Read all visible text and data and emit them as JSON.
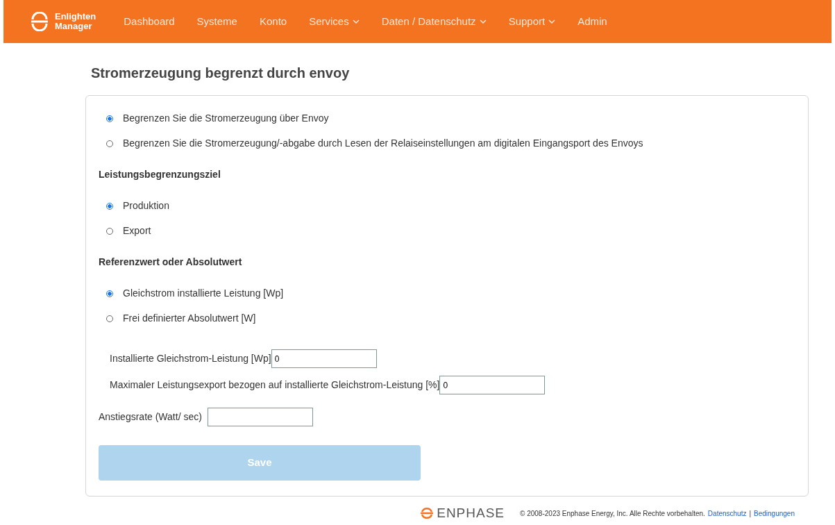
{
  "navbar": {
    "brand": [
      "Enlighten",
      "Manager"
    ],
    "items": [
      {
        "label": "Dashboard",
        "dropdown": false
      },
      {
        "label": "Systeme",
        "dropdown": false
      },
      {
        "label": "Konto",
        "dropdown": false
      },
      {
        "label": "Services",
        "dropdown": true
      },
      {
        "label": "Daten / Datenschutz",
        "dropdown": true
      },
      {
        "label": "Support",
        "dropdown": true
      },
      {
        "label": "Admin",
        "dropdown": false
      }
    ]
  },
  "title": "Stromerzeugung begrenzt durch envoy",
  "mode_options": [
    {
      "label": "Begrenzen Sie die Stromerzeugung über Envoy",
      "selected": true
    },
    {
      "label": "Begrenzen Sie die Stromerzeugung/-abgabe durch Lesen der Relaiseinstellungen am digitalen Eingangsport des Envoys",
      "selected": false
    }
  ],
  "target": {
    "heading": "Leistungsbegrenzungsziel",
    "options": [
      {
        "label": "Produktion",
        "selected": true
      },
      {
        "label": "Export",
        "selected": false
      }
    ]
  },
  "reference": {
    "heading": "Referenzwert oder Absolutwert",
    "options": [
      {
        "label": "Gleichstrom installierte Leistung [Wp]",
        "selected": true
      },
      {
        "label": "Frei definierter Absolutwert [W]",
        "selected": false
      }
    ]
  },
  "limit_fields": [
    {
      "label": "Installierte Gleichstrom-Leistung [Wp]",
      "value": "0"
    },
    {
      "label": "Maximaler Leistungsexport bezogen auf installierte Gleichstrom-Leistung [%]",
      "value": "0"
    }
  ],
  "ramp_field": {
    "label": "Anstiegsrate (Watt/ sec)"
  },
  "save_button": {
    "label": "Save",
    "disabled": true
  },
  "footer": {
    "logo": "ENPHASE",
    "copyright": "© 2008-2023 Enphase Energy, Inc. Alle Rechte vorbehalten.",
    "links": [
      "Datenschutz",
      "Bedingungen"
    ],
    "separator": "|"
  }
}
